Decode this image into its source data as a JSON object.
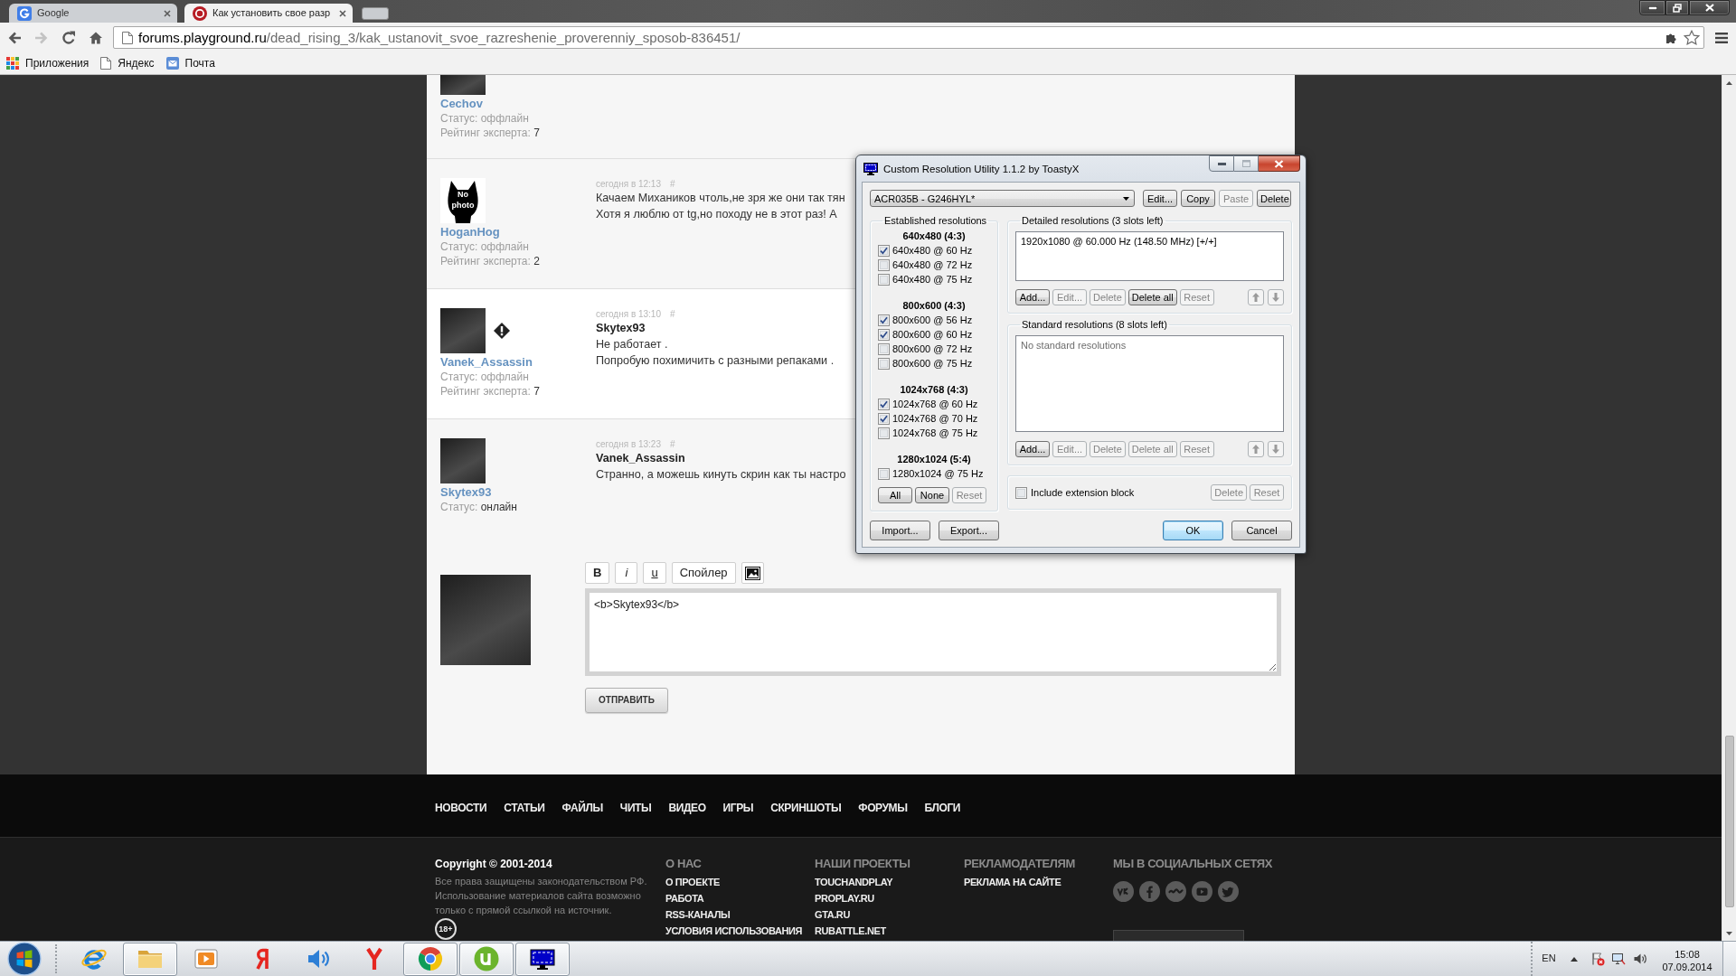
{
  "browser": {
    "tabs": [
      {
        "kind": "google",
        "title": "Google",
        "selected": false
      },
      {
        "kind": "playground",
        "title": "Как установить свое разр",
        "selected": true
      }
    ],
    "nav_buttons": [
      {
        "kind": "back",
        "disabled": false
      },
      {
        "kind": "forward",
        "disabled": true
      },
      {
        "kind": "reload",
        "disabled": false
      },
      {
        "kind": "home",
        "disabled": false
      }
    ],
    "address": {
      "host": "forums.playground.ru",
      "path": "/dead_rising_3/kak_ustanovit_svoe_razreshenie_proverenniy_sposob-836451/"
    },
    "bookmarks": [
      {
        "kind": "apps",
        "label": "Приложения"
      },
      {
        "kind": "page",
        "label": "Яндекс"
      },
      {
        "kind": "mail",
        "label": "Почта"
      }
    ]
  },
  "posts": [
    {
      "avatar": {
        "kind": "photo"
      },
      "warned": false,
      "shaded": true,
      "author": "Cechov",
      "status_label": "Статус:",
      "status": "оффлайн",
      "online": false,
      "rating_label": "Рейтинг эксперта:",
      "rating": "7"
    },
    {
      "avatar": {
        "kind": "no_photo",
        "caption": "No photo"
      },
      "warned": false,
      "shaded": true,
      "author": "HoganHog",
      "status_label": "Статус:",
      "status": "оффлайн",
      "online": false,
      "rating_label": "Рейтинг эксперта:",
      "rating": "2",
      "date": "сегодня в 12:13",
      "permalink": "#",
      "lines": [
        {
          "kind": "text",
          "text": "Качаем Михаников чтоль,не зря же они так тян"
        },
        {
          "kind": "text",
          "text": "Хотя я люблю от tg,но походу не в этот раз! А"
        }
      ]
    },
    {
      "avatar": {
        "kind": "photo"
      },
      "warned": true,
      "shaded": false,
      "author": "Vanek_Assassin",
      "status_label": "Статус:",
      "status": "оффлайн",
      "online": false,
      "rating_label": "Рейтинг эксперта:",
      "rating": "7",
      "date": "сегодня в 13:10",
      "permalink": "#",
      "lines": [
        {
          "kind": "addressee",
          "text": "Skytex93"
        },
        {
          "kind": "text",
          "text": "Не работает ."
        },
        {
          "kind": "text",
          "text": "Попробую похимичить с разными репаками ."
        }
      ]
    },
    {
      "avatar": {
        "kind": "photo"
      },
      "warned": false,
      "shaded": true,
      "author": "Skytex93",
      "status_label": "Статус:",
      "status": "онлайн",
      "online": true,
      "date": "сегодня в 13:23",
      "permalink": "#",
      "lines": [
        {
          "kind": "addressee",
          "text": "Vanek_Assassin"
        },
        {
          "kind": "text",
          "text": "Странно, а можешь кинуть скрин как ты настро"
        }
      ]
    }
  ],
  "reply": {
    "avatar": {
      "kind": "photo"
    },
    "toolbar": [
      {
        "kind": "bold",
        "label": "B"
      },
      {
        "kind": "italic",
        "label": "i"
      },
      {
        "kind": "underline",
        "label": "u"
      },
      {
        "kind": "text",
        "label": "Спойлер"
      },
      {
        "kind": "image"
      }
    ],
    "text": "<b>Skytex93</b>",
    "submit": "ОТПРАВИТЬ"
  },
  "footer": {
    "nav": [
      "НОВОСТИ",
      "СТАТЬИ",
      "ФАЙЛЫ",
      "ЧИТЫ",
      "ВИДЕО",
      "ИГРЫ",
      "СКРИНШОТЫ",
      "ФОРУМЫ",
      "БЛОГИ"
    ],
    "copyright": "Copyright © 2001-2014",
    "rights": "Все права защищены законодательством РФ. Использование материалов сайта возможно только с прямой ссылкой на источник.",
    "age_rating": "18+",
    "columns": [
      {
        "heading": "О НАС",
        "links": [
          "О ПРОЕКТЕ",
          "РАБОТА",
          "RSS-КАНАЛЫ",
          "УСЛОВИЯ ИСПОЛЬЗОВАНИЯ"
        ]
      },
      {
        "heading": "НАШИ ПРОЕКТЫ",
        "links": [
          "TOUCHANDPLAY",
          "PROPLAY.RU",
          "GTA.RU",
          "RUBATTLE.NET"
        ]
      },
      {
        "heading": "РЕКЛАМОДАТЕЛЯМ",
        "links": [
          "РЕКЛАМА НА САЙТЕ"
        ]
      }
    ],
    "social_heading": "МЫ В СОЦИАЛЬНЫХ СЕТЯХ"
  },
  "taskbar": {
    "apps": [
      {
        "kind": "ie",
        "running": false
      },
      {
        "kind": "explorer",
        "running": true
      },
      {
        "kind": "media",
        "running": false
      },
      {
        "kind": "yandex",
        "running": false
      },
      {
        "kind": "sound",
        "running": false
      },
      {
        "kind": "yabrowser",
        "running": false
      },
      {
        "kind": "chrome",
        "running": true
      },
      {
        "kind": "utorrent",
        "running": true
      },
      {
        "kind": "cru",
        "running": true
      }
    ],
    "language": "EN",
    "time": "15:08",
    "date": "07.09.2014"
  },
  "dialog": {
    "title": "Custom Resolution Utility 1.1.2 by ToastyX",
    "monitor": "ACR035B - G246HYL*",
    "monitor_buttons": [
      {
        "label": "Edit...",
        "disabled": false
      },
      {
        "label": "Copy",
        "disabled": false
      },
      {
        "label": "Paste",
        "disabled": true
      },
      {
        "label": "Delete",
        "disabled": false
      }
    ],
    "established": {
      "title": "Established resolutions",
      "groups": [
        {
          "heading": "640x480 (4:3)",
          "items": [
            {
              "label": "640x480 @ 60 Hz",
              "checked": true
            },
            {
              "label": "640x480 @ 72 Hz",
              "checked": false
            },
            {
              "label": "640x480 @ 75 Hz",
              "checked": false
            }
          ]
        },
        {
          "heading": "800x600 (4:3)",
          "items": [
            {
              "label": "800x600 @ 56 Hz",
              "checked": true
            },
            {
              "label": "800x600 @ 60 Hz",
              "checked": true
            },
            {
              "label": "800x600 @ 72 Hz",
              "checked": false
            },
            {
              "label": "800x600 @ 75 Hz",
              "checked": false
            }
          ]
        },
        {
          "heading": "1024x768 (4:3)",
          "items": [
            {
              "label": "1024x768 @ 60 Hz",
              "checked": true
            },
            {
              "label": "1024x768 @ 70 Hz",
              "checked": true
            },
            {
              "label": "1024x768 @ 75 Hz",
              "checked": false
            }
          ]
        },
        {
          "heading": "1280x1024 (5:4)",
          "items": [
            {
              "label": "1280x1024 @ 75 Hz",
              "checked": false
            }
          ]
        }
      ],
      "buttons": [
        {
          "label": "All",
          "disabled": false
        },
        {
          "label": "None",
          "disabled": false
        },
        {
          "label": "Reset",
          "disabled": true
        }
      ]
    },
    "detailed": {
      "title": "Detailed resolutions (3 slots left)",
      "items": [
        {
          "text": "1920x1080 @ 60.000 Hz (148.50 MHz) [+/+]",
          "selected": false
        }
      ],
      "buttons": [
        {
          "label": "Add...",
          "disabled": false
        },
        {
          "label": "Edit...",
          "disabled": true
        },
        {
          "label": "Delete",
          "disabled": true
        },
        {
          "label": "Delete all",
          "disabled": false
        },
        {
          "label": "Reset",
          "disabled": true
        }
      ],
      "move_buttons": [
        {
          "kind": "up",
          "disabled": true
        },
        {
          "kind": "down",
          "disabled": true
        }
      ]
    },
    "standard": {
      "title": "Standard resolutions (8 slots left)",
      "empty_text": "No standard resolutions",
      "buttons": [
        {
          "label": "Add...",
          "disabled": false
        },
        {
          "label": "Edit...",
          "disabled": true
        },
        {
          "label": "Delete",
          "disabled": true
        },
        {
          "label": "Delete all",
          "disabled": true
        },
        {
          "label": "Reset",
          "disabled": true
        }
      ],
      "move_buttons": [
        {
          "kind": "up",
          "disabled": true
        },
        {
          "kind": "down",
          "disabled": true
        }
      ]
    },
    "extension": {
      "label": "Include extension block",
      "checked": false,
      "buttons": [
        {
          "label": "Delete",
          "disabled": true
        },
        {
          "label": "Reset",
          "disabled": true
        }
      ]
    },
    "file_buttons": [
      {
        "label": "Import...",
        "default": false
      },
      {
        "label": "Export...",
        "default": false
      }
    ],
    "buttons": [
      {
        "label": "OK",
        "default": true
      },
      {
        "label": "Cancel",
        "default": false
      }
    ]
  }
}
